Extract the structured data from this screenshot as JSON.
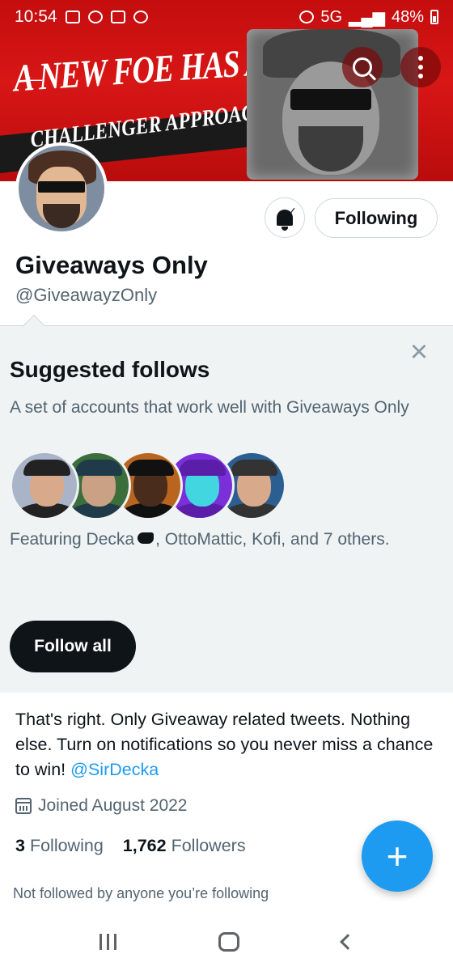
{
  "status_bar": {
    "time": "10:54",
    "network": "5G",
    "battery": "48%"
  },
  "banner": {
    "headline": "A NEW FOE HAS APPEARED!",
    "subline": "CHALLENGER APPROACHING",
    "accent": "#d81616"
  },
  "header_icons": {
    "back": "←"
  },
  "profile": {
    "name": "Giveaways Only",
    "handle": "@GiveawayzOnly",
    "following_button": "Following",
    "bell_check": "✓"
  },
  "suggested": {
    "title": "Suggested follows",
    "description": "A set of accounts that work well with Giveaways Only",
    "close": "×",
    "featuring_prefix": "Featuring Decka",
    "featuring_suffix": ", OttoMattic, Kofi, and 7 others.",
    "follow_all": "Follow all",
    "avatars": [
      {
        "name": "avatar-1",
        "bg": "#a9b4c8",
        "skin": "#d8a98a",
        "cap": "#222"
      },
      {
        "name": "avatar-2",
        "bg": "#3b6e3b",
        "skin": "#caa184",
        "cap": "#1f3b4a"
      },
      {
        "name": "avatar-3",
        "bg": "#b9651f",
        "skin": "#4a2c1c",
        "cap": "#111"
      },
      {
        "name": "avatar-4",
        "bg": "#7a2fd8",
        "skin": "#41d6e0",
        "cap": "#5a1ea8"
      },
      {
        "name": "avatar-5",
        "bg": "#2b5f92",
        "skin": "#d8a98a",
        "cap": "#333"
      }
    ]
  },
  "bio": {
    "text": "That's right. Only Giveaway related tweets. Nothing else. Turn on notifications so you never miss a chance to win! ",
    "mention": "@SirDecka"
  },
  "joined": "Joined August 2022",
  "stats": {
    "following_count": "3",
    "following_label": "Following",
    "followers_count": "1,762",
    "followers_label": "Followers"
  },
  "not_followed": "Not followed by anyone you’re following",
  "fab": "+",
  "colors": {
    "accent_blue": "#1d9bf0",
    "text_secondary": "#536471",
    "panel_bg": "#eff3f4"
  }
}
